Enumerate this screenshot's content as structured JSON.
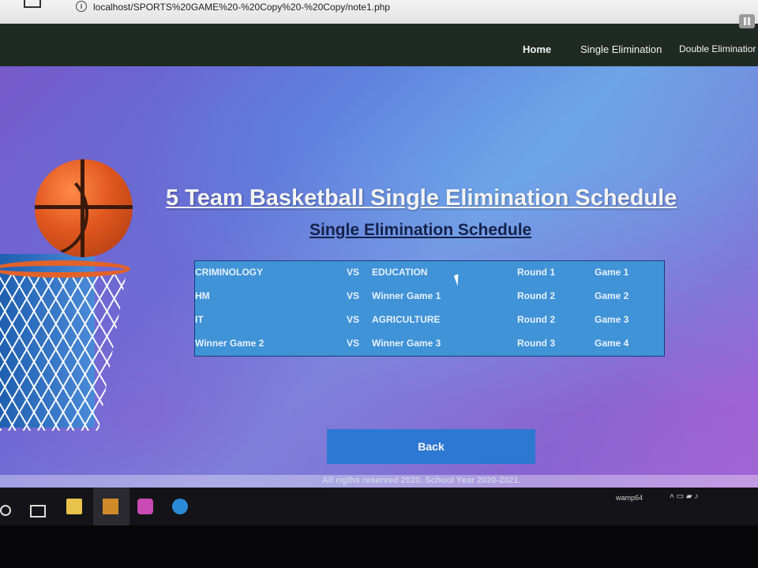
{
  "browser": {
    "url": "localhost/SPORTS%20GAME%20-%20Copy%20-%20Copy/note1.php"
  },
  "nav": {
    "home": "Home",
    "single": "Single Elimination",
    "double": "Double Eliminatior"
  },
  "page": {
    "title": "5 Team Basketball Single Elimination Schedule",
    "subtitle": "Single Elimination Schedule",
    "back_label": "Back",
    "footer": "All rigths reserved 2020. School Year 2020-2021."
  },
  "schedule": {
    "rows": [
      {
        "team1": "CRIMINOLOGY",
        "vs": "VS",
        "team2": "EDUCATION",
        "round": "Round 1",
        "game": "Game 1"
      },
      {
        "team1": "HM",
        "vs": "VS",
        "team2": "Winner Game 1",
        "round": "Round 2",
        "game": "Game 2"
      },
      {
        "team1": "IT",
        "vs": "VS",
        "team2": "AGRICULTURE",
        "round": "Round 2",
        "game": "Game 3"
      },
      {
        "team1": "Winner Game 2",
        "vs": "VS",
        "team2": "Winner Game 3",
        "round": "Round 3",
        "game": "Game 4"
      }
    ]
  },
  "taskbar": {
    "app_label": "wamp64",
    "tray": "˄ ▭ ▰ ♪"
  },
  "colors": {
    "navbar": "#1f2a22",
    "table_bg": "#3f93d6",
    "button_bg": "#2d78d2",
    "subtitle": "#16214a"
  }
}
